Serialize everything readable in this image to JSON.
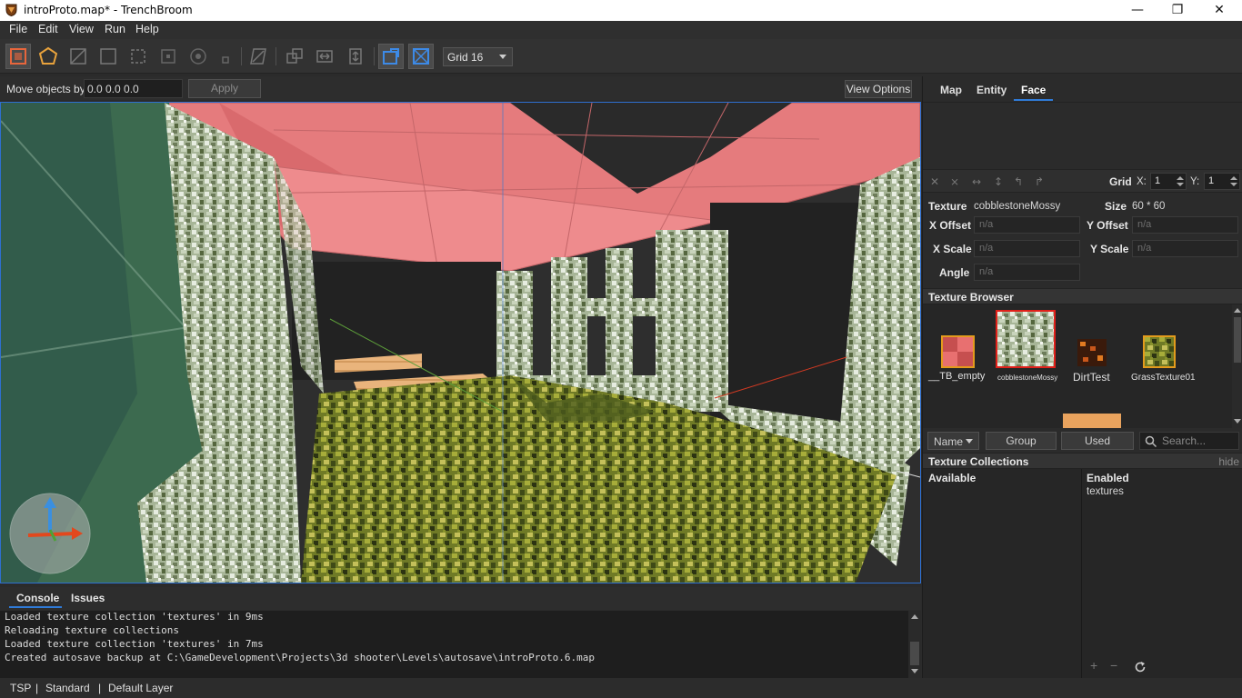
{
  "window": {
    "title": "introProto.map* - TrenchBroom",
    "minimize": "—",
    "maximize": "❐",
    "close": "✕"
  },
  "menu": [
    "File",
    "Edit",
    "View",
    "Run",
    "Help"
  ],
  "toolbar": {
    "grid_select": "Grid 16"
  },
  "movebar": {
    "label": "Move objects by",
    "value": "0.0 0.0 0.0",
    "apply": "Apply",
    "view_options": "View Options"
  },
  "console": {
    "tabs": [
      "Console",
      "Issues"
    ],
    "lines": [
      "Loaded texture collection 'textures' in 9ms",
      "Reloading texture collections",
      "Loaded texture collection 'textures' in 7ms",
      "Created autosave backup at C:\\GameDevelopment\\Projects\\3d shooter\\Levels\\autosave\\introProto.6.map"
    ]
  },
  "status": {
    "engine": "TSP",
    "sep": "|",
    "mode": "Standard",
    "layer": "Default Layer"
  },
  "panel": {
    "tabs": [
      "Map",
      "Entity",
      "Face"
    ],
    "selected_tab": "Face",
    "grid_label": "Grid",
    "grid_x_label": "X:",
    "grid_x": "1",
    "grid_y_label": "Y:",
    "grid_y": "1",
    "texture_label": "Texture",
    "texture_value": "cobblestoneMossy",
    "size_label": "Size",
    "size_value": "60 * 60",
    "x_offset_label": "X Offset",
    "y_offset_label": "Y Offset",
    "x_scale_label": "X Scale",
    "y_scale_label": "Y Scale",
    "angle_label": "Angle",
    "na": "n/a"
  },
  "texture_browser": {
    "title": "Texture Browser",
    "textures": [
      {
        "name": "__TB_empty",
        "selected": false
      },
      {
        "name": "cobblestoneMossy",
        "selected": true
      },
      {
        "name": "DirtTest",
        "selected": false
      },
      {
        "name": "GrassTexture01",
        "selected": false
      }
    ],
    "sort": "Name",
    "group": "Group",
    "used": "Used",
    "search_placeholder": "Search..."
  },
  "collections": {
    "title": "Texture Collections",
    "hide": "hide",
    "available_label": "Available",
    "enabled_label": "Enabled",
    "enabled": [
      "textures"
    ]
  },
  "colors": {
    "accent": "#2f7bd8",
    "ceiling": "#e87a7c",
    "selection": "#e0201a"
  }
}
